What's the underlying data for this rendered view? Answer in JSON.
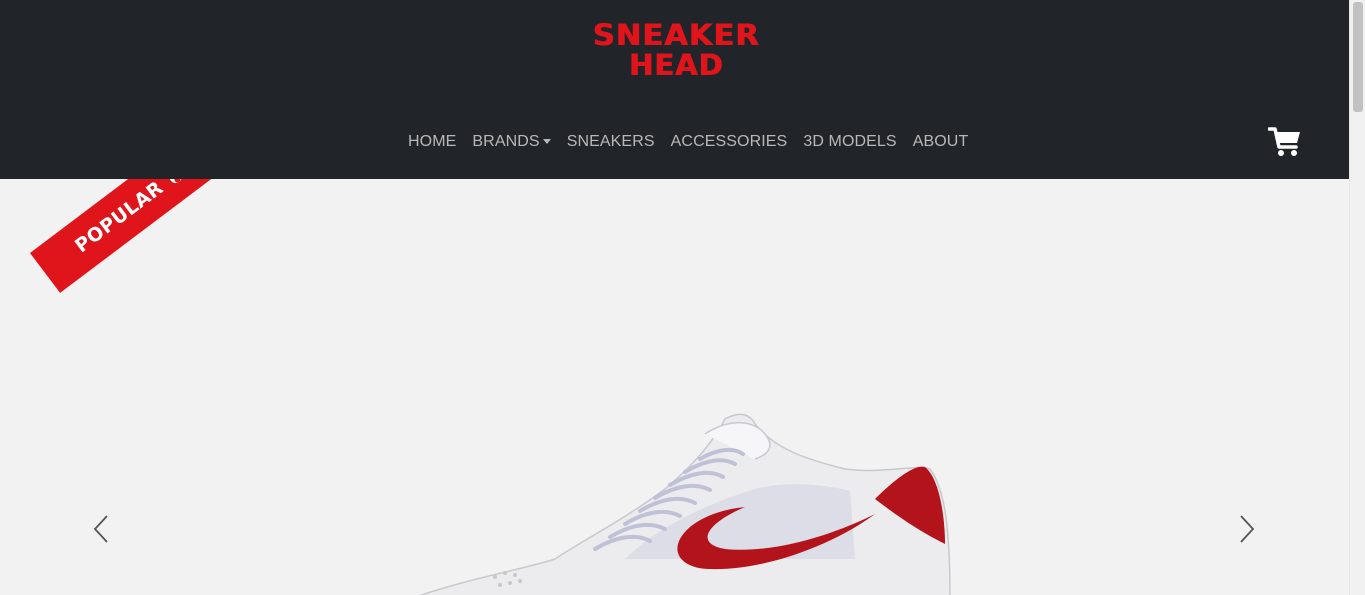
{
  "brand": {
    "logo_line1": "SNEAKER",
    "logo_line2": "HEAD"
  },
  "nav": {
    "items": [
      {
        "label": "HOME"
      },
      {
        "label": "BRANDS"
      },
      {
        "label": "SNEAKERS"
      },
      {
        "label": "ACCESSORIES"
      },
      {
        "label": "3D MODELS"
      },
      {
        "label": "ABOUT"
      }
    ]
  },
  "icons": {
    "cart": "shopping-cart-icon",
    "fire": "fire-icon",
    "prev": "chevron-left-icon",
    "next": "chevron-right-icon"
  },
  "carousel": {
    "badge_label": "POPULAR"
  },
  "colors": {
    "header_bg": "#212529",
    "brand_red": "#e0141b",
    "nav_text": "#b8b8b8",
    "carousel_bg": "#f2f2f2"
  }
}
